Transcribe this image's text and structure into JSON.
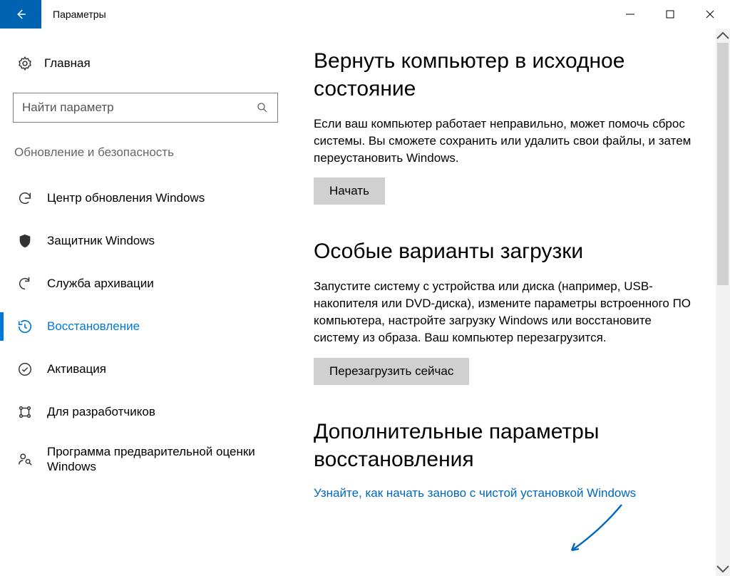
{
  "window": {
    "title": "Параметры"
  },
  "sidebar": {
    "home_label": "Главная",
    "search_placeholder": "Найти параметр",
    "category_label": "Обновление и безопасность",
    "items": [
      {
        "label": "Центр обновления Windows",
        "selected": false
      },
      {
        "label": "Защитник Windows",
        "selected": false
      },
      {
        "label": "Служба архивации",
        "selected": false
      },
      {
        "label": "Восстановление",
        "selected": true
      },
      {
        "label": "Активация",
        "selected": false
      },
      {
        "label": "Для разработчиков",
        "selected": false
      },
      {
        "label": "Программа предварительной оценки Windows",
        "selected": false
      }
    ]
  },
  "content": {
    "reset": {
      "heading": "Вернуть компьютер в исходное состояние",
      "body": "Если ваш компьютер работает неправильно, может помочь сброс системы. Вы сможете сохранить или удалить свои файлы, и затем переустановить Windows.",
      "button": "Начать"
    },
    "advanced_startup": {
      "heading": "Особые варианты загрузки",
      "body": "Запустите систему с устройства или диска (например, USB-накопителя или DVD-диска), измените параметры встроенного ПО компьютера, настройте загрузку Windows или восстановите систему из образа. Ваш компьютер перезагрузится.",
      "button": "Перезагрузить сейчас"
    },
    "more": {
      "heading": "Дополнительные параметры восстановления",
      "link": "Узнайте, как начать заново с чистой установкой Windows"
    }
  }
}
